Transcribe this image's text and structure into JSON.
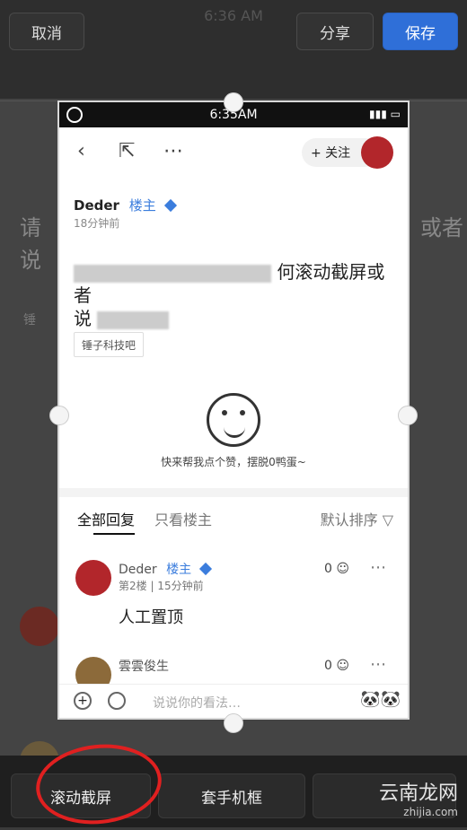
{
  "top_actions": {
    "cancel": "取消",
    "share": "分享",
    "save": "保存",
    "status_time": "6:36 AM"
  },
  "phone": {
    "status_bar_time": "6:35AM",
    "follow_label": "+ 关注",
    "poster": {
      "name": "Deder",
      "badge": "楼主",
      "time": "18分钟前"
    },
    "post_title_visible": "何滚动截屏或者",
    "post_title_line2_prefix": "说",
    "tag_label": "锤子科技吧",
    "like_prompt": "快来帮我点个赞，摆脱0鸭蛋~",
    "tabs": [
      {
        "label": "全部回复",
        "active": true
      },
      {
        "label": "只看楼主",
        "active": false
      }
    ],
    "sort_label": "默认排序",
    "comments": [
      {
        "name": "Deder",
        "badge": "楼主",
        "meta": "第2楼  |  15分钟前",
        "text": "人工置顶",
        "likes": "0"
      },
      {
        "name": "雲雲俊生",
        "likes": "0"
      }
    ],
    "input_placeholder": "说说你的看法…"
  },
  "bottom_tools": {
    "scroll_capture": "滚动截屏",
    "phone_frame": "套手机框",
    "extra": ""
  },
  "watermark": {
    "line1": "云南龙网",
    "line2": "zhijia.com"
  }
}
